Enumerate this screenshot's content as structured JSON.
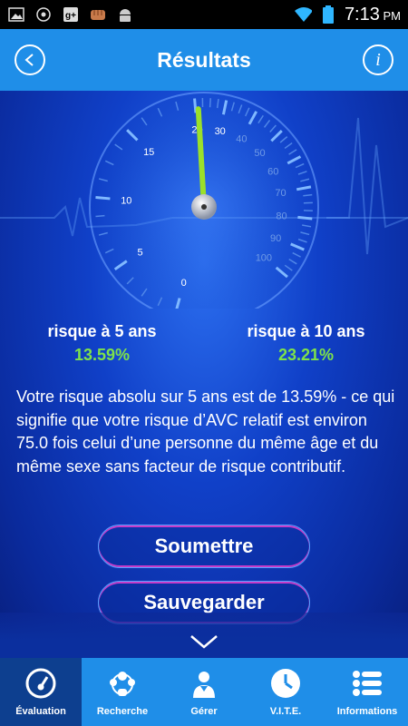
{
  "status_bar": {
    "time": "7:13",
    "ampm": "PM"
  },
  "header": {
    "title": "Résultats"
  },
  "gauge": {
    "value": 21,
    "ticks_left": [
      "0",
      "5",
      "10",
      "15",
      "20"
    ],
    "ticks_right": [
      "30",
      "40",
      "50",
      "60",
      "70",
      "80",
      "90",
      "100"
    ]
  },
  "risks": [
    {
      "label": "risque à 5 ans",
      "value": "13.59%"
    },
    {
      "label": "risque à 10 ans",
      "value": "23.21%"
    }
  ],
  "description": "Votre risque absolu sur 5 ans est de 13.59% - ce qui signifie que votre risque d’AVC relatif est environ 75.0 fois celui d’une personne du même âge et du même sexe sans facteur de risque contributif.",
  "buttons": {
    "submit": "Soumettre",
    "save": "Sauvegarder"
  },
  "nav": [
    {
      "label": "Évaluation",
      "icon": "gauge-icon",
      "active": true
    },
    {
      "label": "Recherche",
      "icon": "people-icon",
      "active": false
    },
    {
      "label": "Gérer",
      "icon": "doctor-icon",
      "active": false
    },
    {
      "label": "V.I.T.E.",
      "icon": "clock-icon",
      "active": false
    },
    {
      "label": "Informations",
      "icon": "list-icon",
      "active": false
    }
  ],
  "colors": {
    "header": "#1f8ee8",
    "accent_green": "#7ee24a",
    "needle": "#9be02a"
  }
}
